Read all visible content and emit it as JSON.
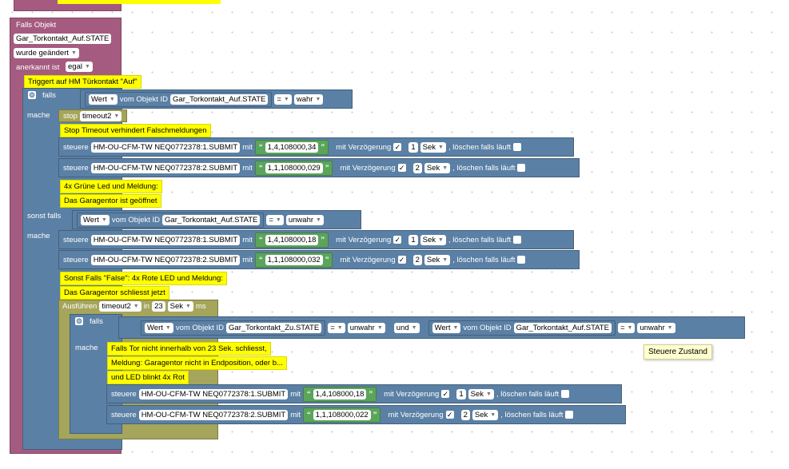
{
  "trigger": {
    "title": "Falls Objekt",
    "object_id": "Gar_Torkontakt_Auf.STATE",
    "changed_label": "wurde geändert",
    "ack_label": "anerkannt ist",
    "ack_value": "egal"
  },
  "comments": {
    "c1": "Triggert auf HM Türkontakt \"Auf\"",
    "c2": "Stop Timeout verhindert Falschmeldungen",
    "c3": "4x Grüne Led und Meldung:",
    "c4": "Das Garagentor ist geöffnet",
    "c5": "Sonst Falls \"False\": 4x Rote LED und Meldung:",
    "c6": "Das Garagentor schliesst jetzt",
    "c7": "Falls Tor nicht innerhalb von 23 Sek. schliesst,",
    "c8": "Meldung: Garagentor nicht in Endposition, oder b...",
    "c9": "und LED blinkt 4x Rot"
  },
  "labels": {
    "falls": "falls",
    "mache": "mache",
    "sonst_falls": "sonst falls",
    "wert": "Wert",
    "vom_objekt": "vom Objekt ID",
    "eq": "=",
    "stop": "stop",
    "steuere": "steuere",
    "mit": "mit",
    "mit_verz": "mit Verzögerung",
    "loeschen": ", löschen falls läuft",
    "ausfuehren": "Ausführen",
    "in": "in",
    "ms": "ms",
    "und": "und",
    "open_quote": "“",
    "close_quote": "”",
    "check": "✓"
  },
  "if1": {
    "object": "Gar_Torkontakt_Auf.STATE",
    "value": "wahr",
    "timeout": "timeout2",
    "rows": [
      {
        "device": "HM-OU-CFM-TW NEQ0772378:1.SUBMIT",
        "text": "1,4,108000,34",
        "delay": "1",
        "unit": "Sek"
      },
      {
        "device": "HM-OU-CFM-TW NEQ0772378:2.SUBMIT",
        "text": "1,1,108000,029",
        "delay": "2",
        "unit": "Sek"
      }
    ]
  },
  "elseif": {
    "object": "Gar_Torkontakt_Auf.STATE",
    "value": "unwahr",
    "rows": [
      {
        "device": "HM-OU-CFM-TW NEQ0772378:1.SUBMIT",
        "text": "1,4,108000,18",
        "delay": "1",
        "unit": "Sek"
      },
      {
        "device": "HM-OU-CFM-TW NEQ0772378:2.SUBMIT",
        "text": "1,1,108000,032",
        "delay": "2",
        "unit": "Sek"
      }
    ],
    "exec": {
      "timeout": "timeout2",
      "in": "23",
      "unit": "Sek"
    }
  },
  "if2": {
    "object_a": "Gar_Torkontakt_Zu.STATE",
    "value_a": "unwahr",
    "and": "und",
    "object_b": "Gar_Torkontakt_Auf.STATE",
    "value_b": "unwahr",
    "rows": [
      {
        "device": "HM-OU-CFM-TW NEQ0772378:1.SUBMIT",
        "text": "1,4,108000,18",
        "delay": "1",
        "unit": "Sek"
      },
      {
        "device": "HM-OU-CFM-TW NEQ0772378:2.SUBMIT",
        "text": "1,1,108000,022",
        "delay": "2",
        "unit": "Sek"
      }
    ]
  },
  "tooltip": "Steuere Zustand",
  "colors": {
    "event": "#a55b80",
    "logic": "#5b80a5",
    "timer": "#a5a55b",
    "text": "#5ba55b",
    "comment": "#ffff00"
  }
}
